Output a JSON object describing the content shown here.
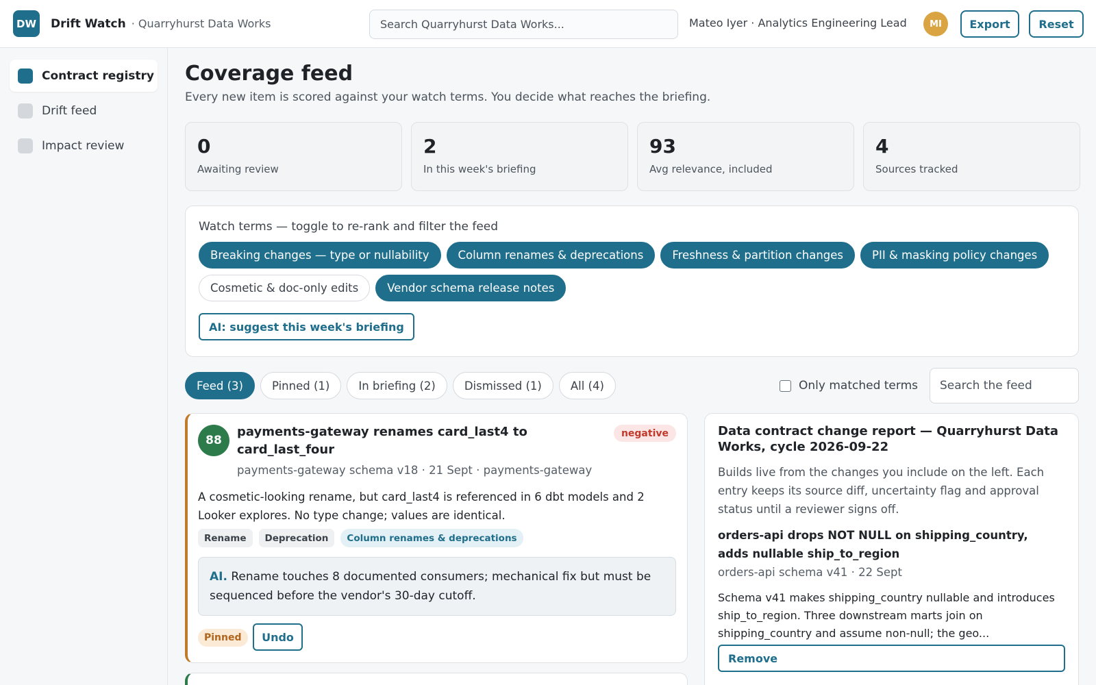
{
  "header": {
    "logo": "DW",
    "app_name": "Drift Watch",
    "org": "· Quarryhurst Data Works",
    "search_placeholder": "Search Quarryhurst Data Works...",
    "user": "Mateo Iyer · Analytics Engineering Lead",
    "avatar": "MI",
    "export_label": "Export",
    "reset_label": "Reset"
  },
  "sidebar": {
    "items": [
      {
        "label": "Contract registry",
        "active": true
      },
      {
        "label": "Drift feed",
        "active": false
      },
      {
        "label": "Impact review",
        "active": false
      }
    ]
  },
  "main": {
    "title": "Coverage feed",
    "subtitle": "Every new item is scored against your watch terms. You decide what reaches the briefing.",
    "stats": [
      {
        "value": "0",
        "label": "Awaiting review"
      },
      {
        "value": "2",
        "label": "In this week's briefing"
      },
      {
        "value": "93",
        "label": "Avg relevance, included"
      },
      {
        "value": "4",
        "label": "Sources tracked"
      }
    ],
    "watch": {
      "label": "Watch terms — toggle to re-rank and filter the feed",
      "terms": [
        {
          "label": "Breaking changes — type or nullability",
          "on": true
        },
        {
          "label": "Column renames & deprecations",
          "on": true
        },
        {
          "label": "Freshness & partition changes",
          "on": true
        },
        {
          "label": "PII & masking policy changes",
          "on": true
        },
        {
          "label": "Cosmetic & doc-only edits",
          "on": false
        },
        {
          "label": "Vendor schema release notes",
          "on": true
        }
      ],
      "ai_button": "AI: suggest this week's briefing"
    },
    "tabs": [
      {
        "label": "Feed (3)",
        "active": true
      },
      {
        "label": "Pinned (1)",
        "active": false
      },
      {
        "label": "In briefing (2)",
        "active": false
      },
      {
        "label": "Dismissed (1)",
        "active": false
      },
      {
        "label": "All (4)",
        "active": false
      }
    ],
    "only_matched_label": "Only matched terms",
    "feed_search_placeholder": "Search the feed"
  },
  "feed": {
    "item": {
      "score": "88",
      "title": "payments-gateway renames card_last4 to card_last_four",
      "sentiment": "negative",
      "meta": "payments-gateway schema v18 · 21 Sept · payments-gateway",
      "body": "A cosmetic-looking rename, but card_last4 is referenced in 6 dbt models and 2 Looker explores. No type change; values are identical.",
      "tags": [
        "Rename",
        "Deprecation"
      ],
      "matched_term": "Column renames & deprecations",
      "ai_label": "AI.",
      "ai_text": "Rename touches 8 documented consumers; mechanical fix but must be sequenced before the vendor's 30-day cutoff.",
      "status": "Pinned",
      "undo_label": "Undo"
    }
  },
  "report": {
    "title": "Data contract change report — Quarryhurst Data Works, cycle 2026-09-22",
    "description": "Builds live from the changes you include on the left. Each entry keeps its source diff, uncertainty flag and approval status until a reviewer signs off.",
    "entry": {
      "title": "orders-api drops NOT NULL on shipping_country, adds nullable ship_to_region",
      "meta": "orders-api schema v41 · 22 Sept",
      "body": "Schema v41 makes shipping_country nullable and introduces ship_to_region. Three downstream marts join on shipping_country and assume non-null; the geo...",
      "remove_label": "Remove"
    }
  },
  "colors": {
    "accent": "#1f6e8c",
    "score_green": "#2d7a4b",
    "pinned_orange": "#c17a2c",
    "negative_red": "#c0392b"
  }
}
